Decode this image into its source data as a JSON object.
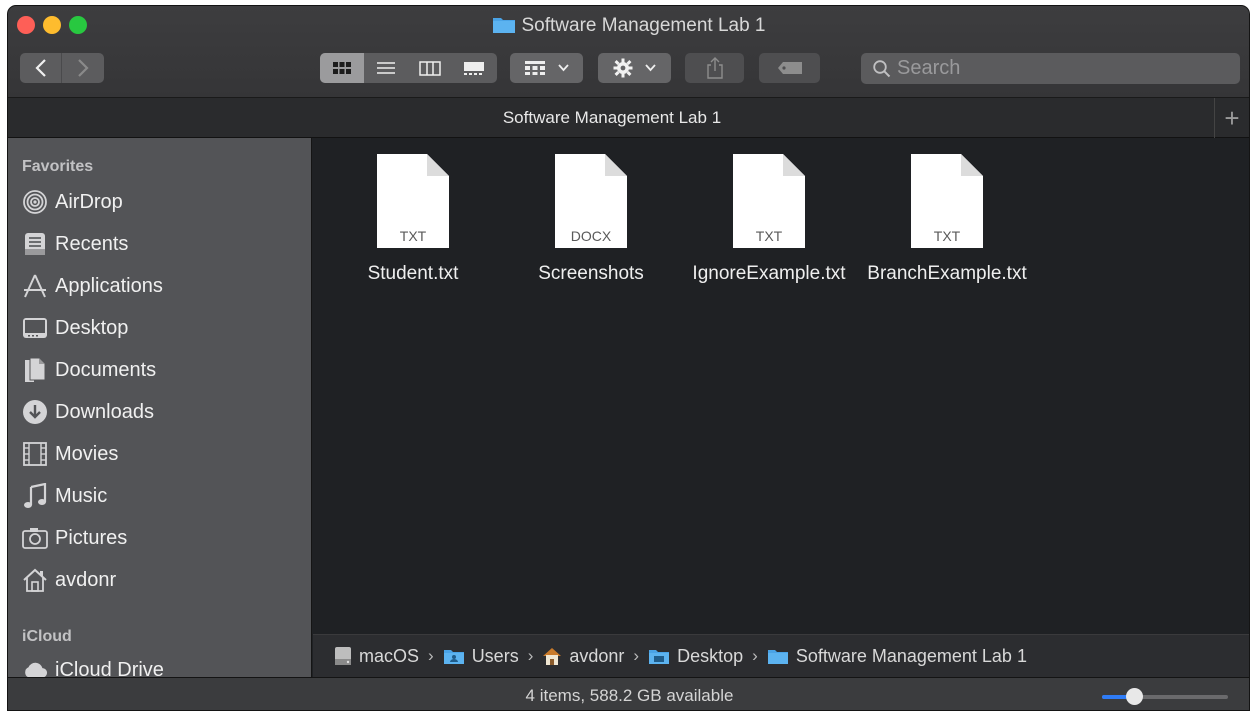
{
  "window": {
    "title": "Software Management Lab 1"
  },
  "toolbar": {
    "search_placeholder": "Search",
    "view_modes": [
      "icon-view",
      "list-view",
      "column-view",
      "gallery-view"
    ],
    "active_view": "icon-view"
  },
  "tab": {
    "label": "Software Management Lab 1"
  },
  "sidebar": {
    "favorites_heading": "Favorites",
    "favorites": [
      {
        "label": "AirDrop",
        "icon": "airdrop-icon"
      },
      {
        "label": "Recents",
        "icon": "recents-icon"
      },
      {
        "label": "Applications",
        "icon": "applications-icon"
      },
      {
        "label": "Desktop",
        "icon": "desktop-icon"
      },
      {
        "label": "Documents",
        "icon": "documents-icon"
      },
      {
        "label": "Downloads",
        "icon": "downloads-icon"
      },
      {
        "label": "Movies",
        "icon": "movies-icon"
      },
      {
        "label": "Music",
        "icon": "music-icon"
      },
      {
        "label": "Pictures",
        "icon": "pictures-icon"
      },
      {
        "label": "avdonr",
        "icon": "home-icon"
      }
    ],
    "icloud_heading": "iCloud",
    "icloud": [
      {
        "label": "iCloud Drive",
        "icon": "cloud-icon"
      }
    ]
  },
  "files": [
    {
      "name": "Student.txt",
      "ext": "TXT"
    },
    {
      "name": "Screenshots",
      "ext": "DOCX"
    },
    {
      "name": "IgnoreExample.txt",
      "ext": "TXT"
    },
    {
      "name": "BranchExample.txt",
      "ext": "TXT"
    }
  ],
  "pathbar": {
    "crumbs": [
      {
        "label": "macOS",
        "icon": "disk-icon"
      },
      {
        "label": "Users",
        "icon": "users-folder-icon"
      },
      {
        "label": "avdonr",
        "icon": "home-icon"
      },
      {
        "label": "Desktop",
        "icon": "desktop-folder-icon"
      },
      {
        "label": "Software Management Lab 1",
        "icon": "folder-icon"
      }
    ]
  },
  "status": {
    "text": "4 items, 588.2 GB available",
    "icon_size_fraction": 0.25
  },
  "colors": {
    "folder": "#4aa3e6",
    "accent": "#2f7cf6"
  }
}
